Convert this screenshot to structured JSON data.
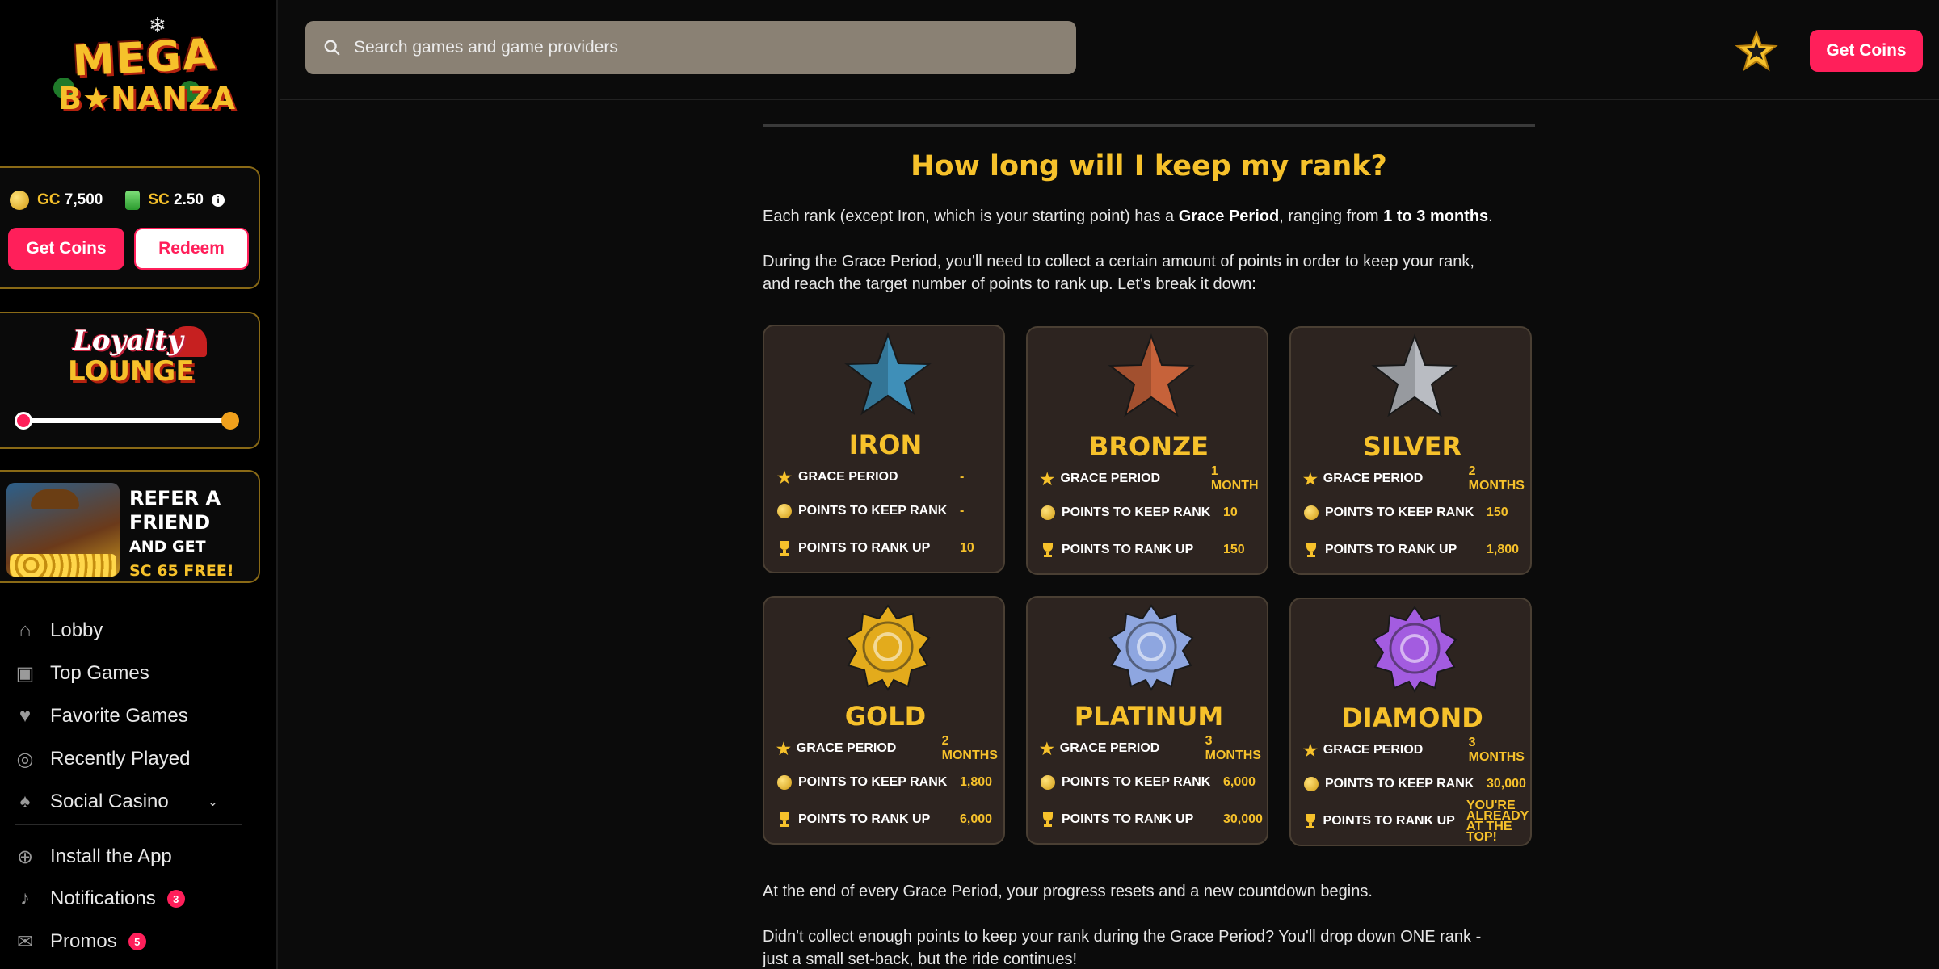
{
  "brand": {
    "line1": "MEGA",
    "line2": "B★NANZA"
  },
  "header": {
    "search_placeholder": "Search games and game providers",
    "get_coins": "Get Coins"
  },
  "wallet": {
    "gc_label": "GC",
    "gc_value": "7,500",
    "sc_label": "SC",
    "sc_value": "2.50",
    "get_coins": "Get Coins",
    "redeem": "Redeem"
  },
  "loyalty": {
    "line1": "Loyalty",
    "line2": "LOUNGE",
    "progress": 0.0
  },
  "refer": {
    "line1": "REFER A",
    "line2": "FRIEND",
    "line3": "AND GET",
    "line4": "SC 65 FREE!"
  },
  "nav": {
    "lobby": "Lobby",
    "top_games": "Top Games",
    "favorite_games": "Favorite Games",
    "recently_played": "Recently Played",
    "social_casino": "Social Casino",
    "install_app": "Install the App",
    "notifications": "Notifications",
    "notifications_count": "3",
    "promos": "Promos",
    "promos_count": "5"
  },
  "content": {
    "heading": "How long will I keep my rank?",
    "p1_a": "Each rank (except Iron, which is your starting point) has a ",
    "p1_b": "Grace Period",
    "p1_c": ", ranging from ",
    "p1_d": "1 to 3 months",
    "p1_e": ".",
    "p2_line1": "During the Grace Period, you'll need to collect a certain amount of points in order to keep your rank,",
    "p2_line2": "and reach the target number of points to rank up. Let's break it down:",
    "p3": "At the end of every Grace Period, your progress resets and a new countdown begins.",
    "p4_line1": "Didn't collect enough points to keep your rank during the Grace Period? You'll drop down ONE rank -",
    "p4_line2": "just a small set-back, but the ride continues!"
  },
  "row_labels": {
    "grace": "GRACE PERIOD",
    "keep": "POINTS TO KEEP RANK",
    "up": "POINTS TO RANK UP"
  },
  "ranks": [
    {
      "name": "IRON",
      "grace": "-",
      "keep": "-",
      "up": "10",
      "color": "#3f8fb8"
    },
    {
      "name": "BRONZE",
      "grace": "1 MONTH",
      "keep": "10",
      "up": "150",
      "color": "#c6623a"
    },
    {
      "name": "SILVER",
      "grace": "2 MONTHS",
      "keep": "150",
      "up": "1,800",
      "color": "#b9bcc2"
    },
    {
      "name": "GOLD",
      "grace": "2 MONTHS",
      "keep": "1,800",
      "up": "6,000",
      "color": "#e3ab1c"
    },
    {
      "name": "PLATINUM",
      "grace": "3 MONTHS",
      "keep": "6,000",
      "up": "30,000",
      "color": "#8ea6e0"
    },
    {
      "name": "DIAMOND",
      "grace": "3 MONTHS",
      "keep": "30,000",
      "up": "YOU'RE ALREADY AT THE TOP!",
      "color": "#a35ce0"
    }
  ],
  "colors": {
    "accent_pink": "#ff1f5a",
    "accent_gold": "#f6c12b",
    "card_bg": "#2d2420"
  }
}
